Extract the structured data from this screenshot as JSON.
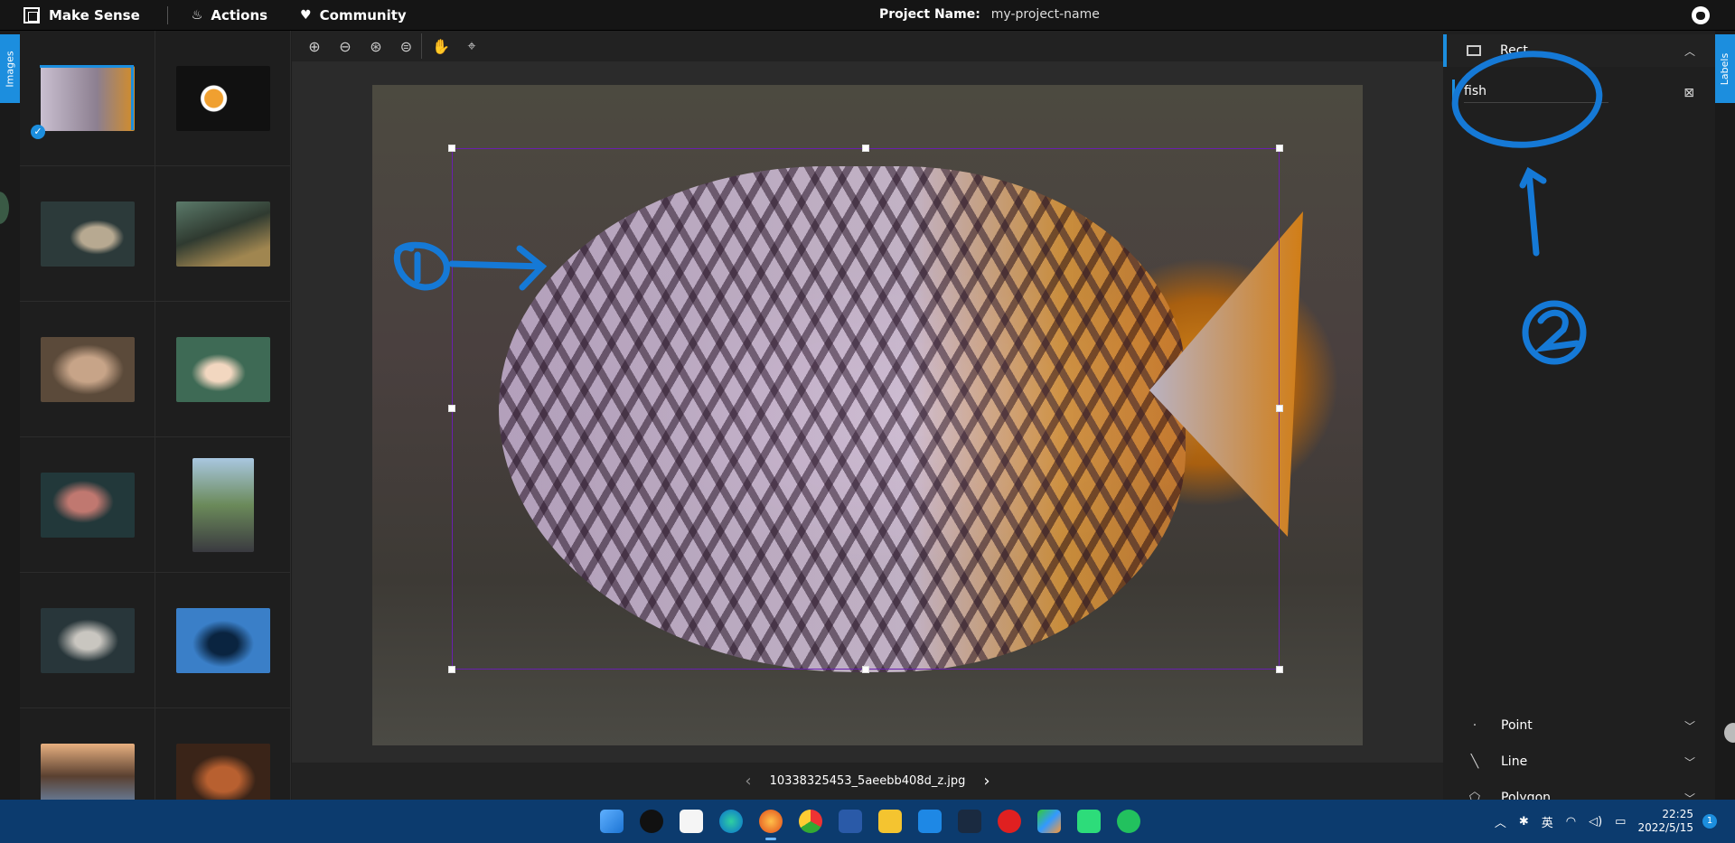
{
  "app": {
    "title": "Make Sense",
    "menu": [
      {
        "label": "Actions",
        "icon": "flame-icon"
      },
      {
        "label": "Community",
        "icon": "heart-icon"
      }
    ],
    "project_label": "Project Name:",
    "project_name": "my-project-name"
  },
  "sidebar_left": {
    "tab_label": "Images"
  },
  "sidebar_right": {
    "tab_label": "Labels"
  },
  "editor": {
    "file_name": "10338325453_5aeebb408d_z.jpg"
  },
  "labels_panel": {
    "active_tool": "Rect",
    "labels": [
      {
        "name": "fish"
      }
    ],
    "tools": [
      {
        "name": "Point"
      },
      {
        "name": "Line"
      },
      {
        "name": "Polygon"
      }
    ]
  },
  "taskbar": {
    "input_method": "英",
    "time": "22:25",
    "date": "2022/5/15",
    "notification_count": "1"
  },
  "annotations": {
    "marker_1": "①",
    "marker_2": "②"
  },
  "colors": {
    "accent": "#1c8ede",
    "bbox": "#6a1fb0",
    "annotation_ink": "#1579d6"
  }
}
